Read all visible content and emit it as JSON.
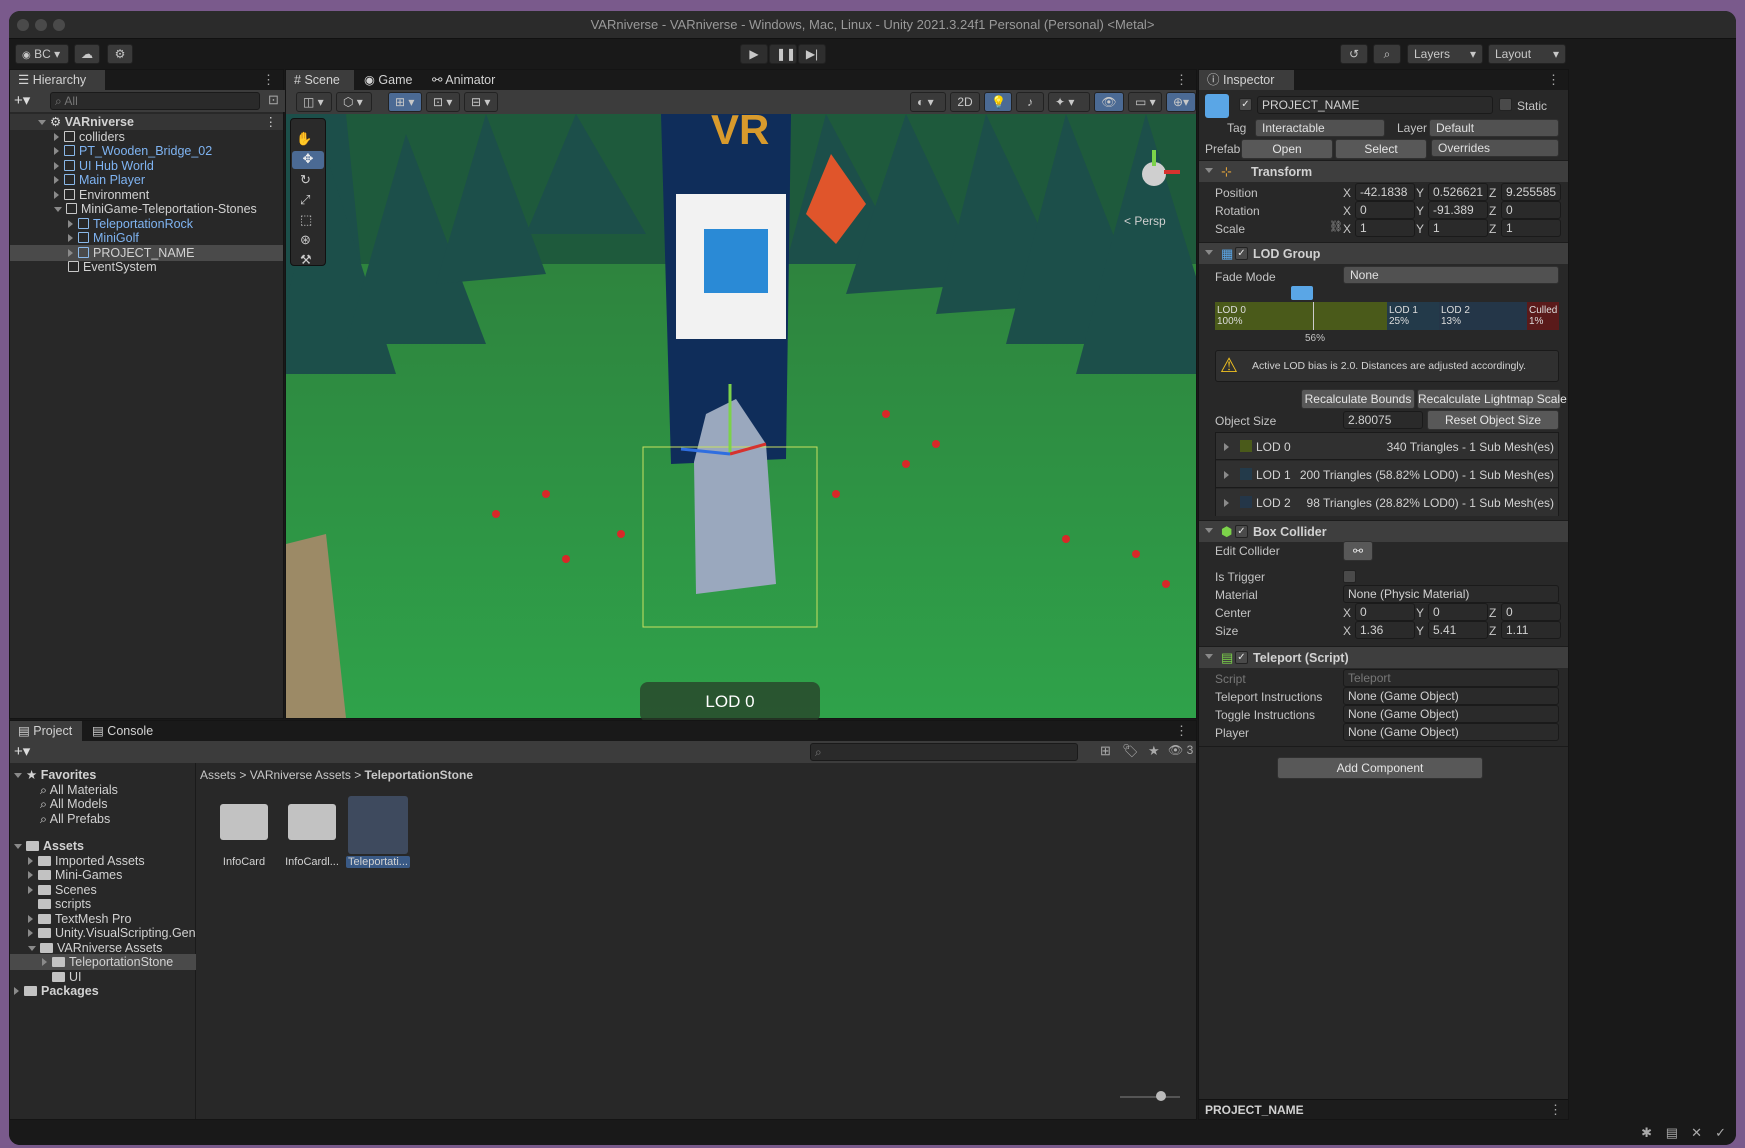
{
  "window": {
    "title": "VARniverse - VARniverse - Windows, Mac, Linux - Unity 2021.3.24f1 Personal (Personal) <Metal>"
  },
  "toolbar": {
    "account": "BC",
    "layers": "Layers",
    "layout": "Layout"
  },
  "hierarchy": {
    "tab": "Hierarchy",
    "search_placeholder": "All",
    "root": "VARniverse",
    "items": [
      "colliders",
      "PT_Wooden_Bridge_02",
      "UI Hub World",
      "Main Player",
      "Environment",
      "MiniGame-Teleportation-Stones",
      "TeleportationRock",
      "MiniGolf",
      "PROJECT_NAME",
      "EventSystem"
    ]
  },
  "scene": {
    "tabs": [
      "Scene",
      "Game",
      "Animator"
    ],
    "mode_2d": "2D",
    "persp": "< Persp",
    "lod_label": "LOD 0"
  },
  "project": {
    "tabs": [
      "Project",
      "Console"
    ],
    "badge_count": "3",
    "favorites": "Favorites",
    "fav_items": [
      "All Materials",
      "All Models",
      "All Prefabs"
    ],
    "assets": "Assets",
    "asset_folders": [
      "Imported Assets",
      "Mini-Games",
      "Scenes",
      "scripts",
      "TextMesh Pro",
      "Unity.VisualScripting.Genera",
      "VARniverse Assets",
      "TeleportationStone",
      "UI"
    ],
    "packages": "Packages",
    "breadcrumb": [
      "Assets",
      "VARniverse Assets",
      "TeleportationStone"
    ],
    "files": [
      "InfoCard",
      "InfoCardl...",
      "Teleportati..."
    ]
  },
  "inspector": {
    "tab": "Inspector",
    "name": "PROJECT_NAME",
    "static": "Static",
    "tag_label": "Tag",
    "tag": "Interactable",
    "layer_label": "Layer",
    "layer": "Default",
    "prefab_label": "Prefab",
    "open": "Open",
    "select": "Select",
    "overrides": "Overrides",
    "transform": {
      "title": "Transform",
      "position": "Position",
      "rotation": "Rotation",
      "scale": "Scale",
      "pos": [
        "-42.1838",
        "0.526621",
        "9.255585"
      ],
      "rot": [
        "0",
        "-91.389",
        "0"
      ],
      "scl": [
        "1",
        "1",
        "1"
      ]
    },
    "lod": {
      "title": "LOD Group",
      "fade_mode_label": "Fade Mode",
      "fade_mode": "None",
      "bar": [
        {
          "name": "LOD 0",
          "pct": "100%"
        },
        {
          "name": "LOD 1",
          "pct": "25%"
        },
        {
          "name": "LOD 2",
          "pct": "13%"
        },
        {
          "name": "Culled",
          "pct": "1%"
        }
      ],
      "marker": "56%",
      "warning": "Active LOD bias is 2.0. Distances are adjusted accordingly.",
      "recalc_bounds": "Recalculate Bounds",
      "recalc_lightmap": "Recalculate Lightmap Scale",
      "object_size_label": "Object Size",
      "object_size": "2.80075",
      "reset_size": "Reset Object Size",
      "levels": [
        {
          "name": "LOD 0",
          "info": "340 Triangles  - 1 Sub Mesh(es)"
        },
        {
          "name": "LOD 1",
          "info": "200 Triangles (58.82% LOD0) - 1 Sub Mesh(es)"
        },
        {
          "name": "LOD 2",
          "info": "98 Triangles (28.82% LOD0) - 1 Sub Mesh(es)"
        }
      ]
    },
    "box": {
      "title": "Box Collider",
      "edit": "Edit Collider",
      "trigger": "Is Trigger",
      "material_label": "Material",
      "material": "None (Physic Material)",
      "center": "Center",
      "size": "Size",
      "center_v": [
        "0",
        "0",
        "0"
      ],
      "size_v": [
        "1.36",
        "5.41",
        "1.11"
      ]
    },
    "teleport": {
      "title": "Teleport (Script)",
      "script_label": "Script",
      "script": "Teleport",
      "instr_label": "Teleport Instructions",
      "instr": "None (Game Object)",
      "toggle_label": "Toggle Instructions",
      "toggle": "None (Game Object)",
      "player_label": "Player",
      "player": "None (Game Object)"
    },
    "add_component": "Add Component",
    "footer": "PROJECT_NAME"
  },
  "axes": {
    "x": "X",
    "y": "Y",
    "z": "Z"
  }
}
